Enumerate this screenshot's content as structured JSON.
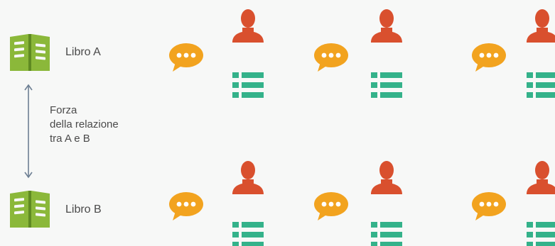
{
  "book_a": {
    "label": "Libro A"
  },
  "book_b": {
    "label": "Libro B"
  },
  "relation": {
    "lines": [
      "Forza",
      "della relazione",
      "tra A e B"
    ]
  },
  "icons": {
    "book": "book-icon",
    "speech": "speech-bubble-icon",
    "person": "person-icon",
    "list": "list-icon",
    "arrow": "double-arrow-icon"
  },
  "colors": {
    "book_green": "#8bb83a",
    "book_dark": "#5f8a22",
    "speech_orange": "#f2a31f",
    "person_red": "#d9502e",
    "list_teal": "#34b28a",
    "arrow": "#6d7f93",
    "text": "#4a4a4a",
    "background": "#f7f8f7"
  }
}
